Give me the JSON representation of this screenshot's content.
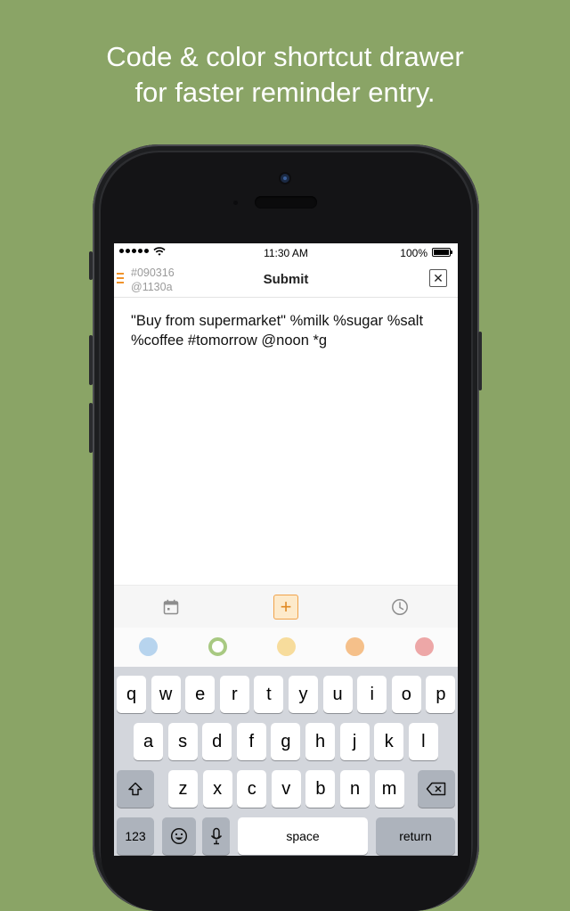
{
  "headline": {
    "line1": "Code & color shortcut drawer",
    "line2": "for faster reminder entry."
  },
  "statusbar": {
    "time": "11:30 AM",
    "battery": "100%"
  },
  "navbar": {
    "date_code": "#090316",
    "time_code": "@1130a",
    "title": "Submit",
    "close_label": "✕"
  },
  "reminder": {
    "text": "\"Buy from supermarket\" %milk %sugar %salt %coffee #tomorrow @noon *g"
  },
  "toolbar": {
    "items": [
      {
        "icon": "calendar-icon"
      },
      {
        "icon": "plus-icon",
        "label": "+"
      },
      {
        "icon": "clock-icon"
      }
    ]
  },
  "colors": [
    {
      "name": "blue",
      "hex": "#b7d4ee",
      "selected": false
    },
    {
      "name": "green",
      "hex": "#a8c982",
      "selected": true
    },
    {
      "name": "yellow",
      "hex": "#f7dc9c",
      "selected": false
    },
    {
      "name": "orange",
      "hex": "#f5c08a",
      "selected": false
    },
    {
      "name": "red",
      "hex": "#eda7a7",
      "selected": false
    }
  ],
  "keyboard": {
    "row1": [
      "q",
      "w",
      "e",
      "r",
      "t",
      "y",
      "u",
      "i",
      "o",
      "p"
    ],
    "row2": [
      "a",
      "s",
      "d",
      "f",
      "g",
      "h",
      "j",
      "k",
      "l"
    ],
    "row3": [
      "z",
      "x",
      "c",
      "v",
      "b",
      "n",
      "m"
    ],
    "numbers_label": "123",
    "space_label": "space",
    "return_label": "return"
  }
}
